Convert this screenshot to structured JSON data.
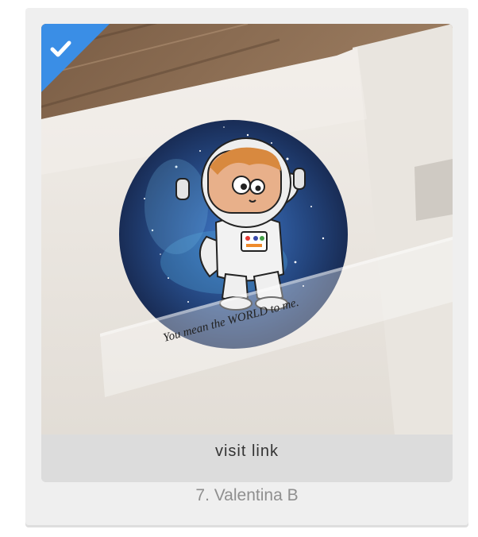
{
  "entry": {
    "image_alt": "Card with astronaut in space circle",
    "card_sentiment": "You mean the WORLD to me.",
    "check_icon": "checkmark-icon",
    "badge_color": "#3a8ee6",
    "visit_label": "visit link",
    "name": "7. Valentina B"
  }
}
